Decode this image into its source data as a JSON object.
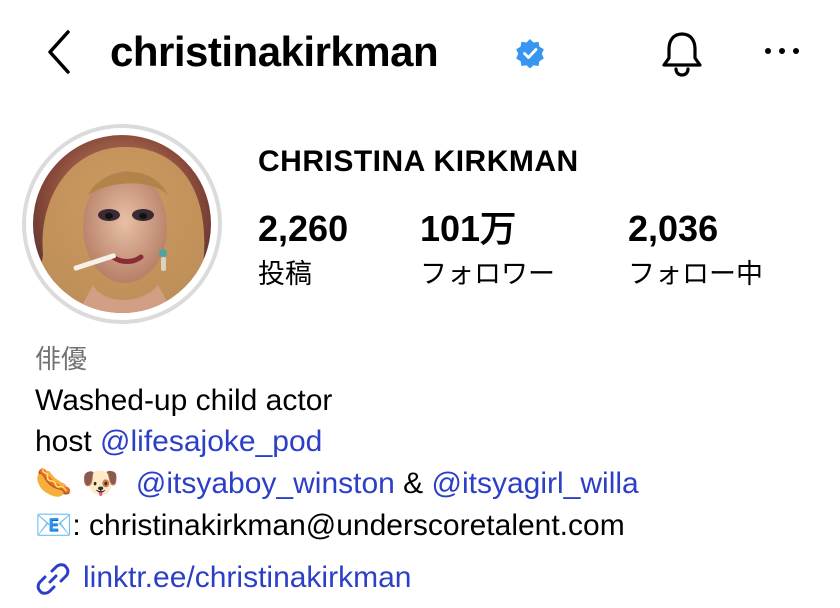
{
  "header": {
    "username": "christinakirkman",
    "verified": true
  },
  "profile": {
    "display_name": "CHRISTINA KIRKMAN",
    "stats": [
      {
        "count": "2,260",
        "label": "投稿"
      },
      {
        "count": "101万",
        "label": "フォロワー"
      },
      {
        "count": "2,036",
        "label": "フォロー中"
      }
    ]
  },
  "bio": {
    "category": "俳優",
    "line1": "Washed-up child actor",
    "line2_prefix": "host ",
    "line2_mention": "@lifesajoke_pod",
    "line3_emojis": "🌭 🐶",
    "line3_mention1": "@itsyaboy_winston",
    "line3_and": " & ",
    "line3_mention2": "@itsyagirl_willa",
    "line4_icon": "📧",
    "line4_text": ": christinakirkman@underscoretalent.com"
  },
  "link": {
    "text": "linktr.ee/christinakirkman",
    "icon": "link-icon"
  },
  "colors": {
    "link": "#2c3fc7",
    "verified": "#3797f0",
    "muted": "#737373",
    "avatar_ring": "#dbdbdb"
  }
}
